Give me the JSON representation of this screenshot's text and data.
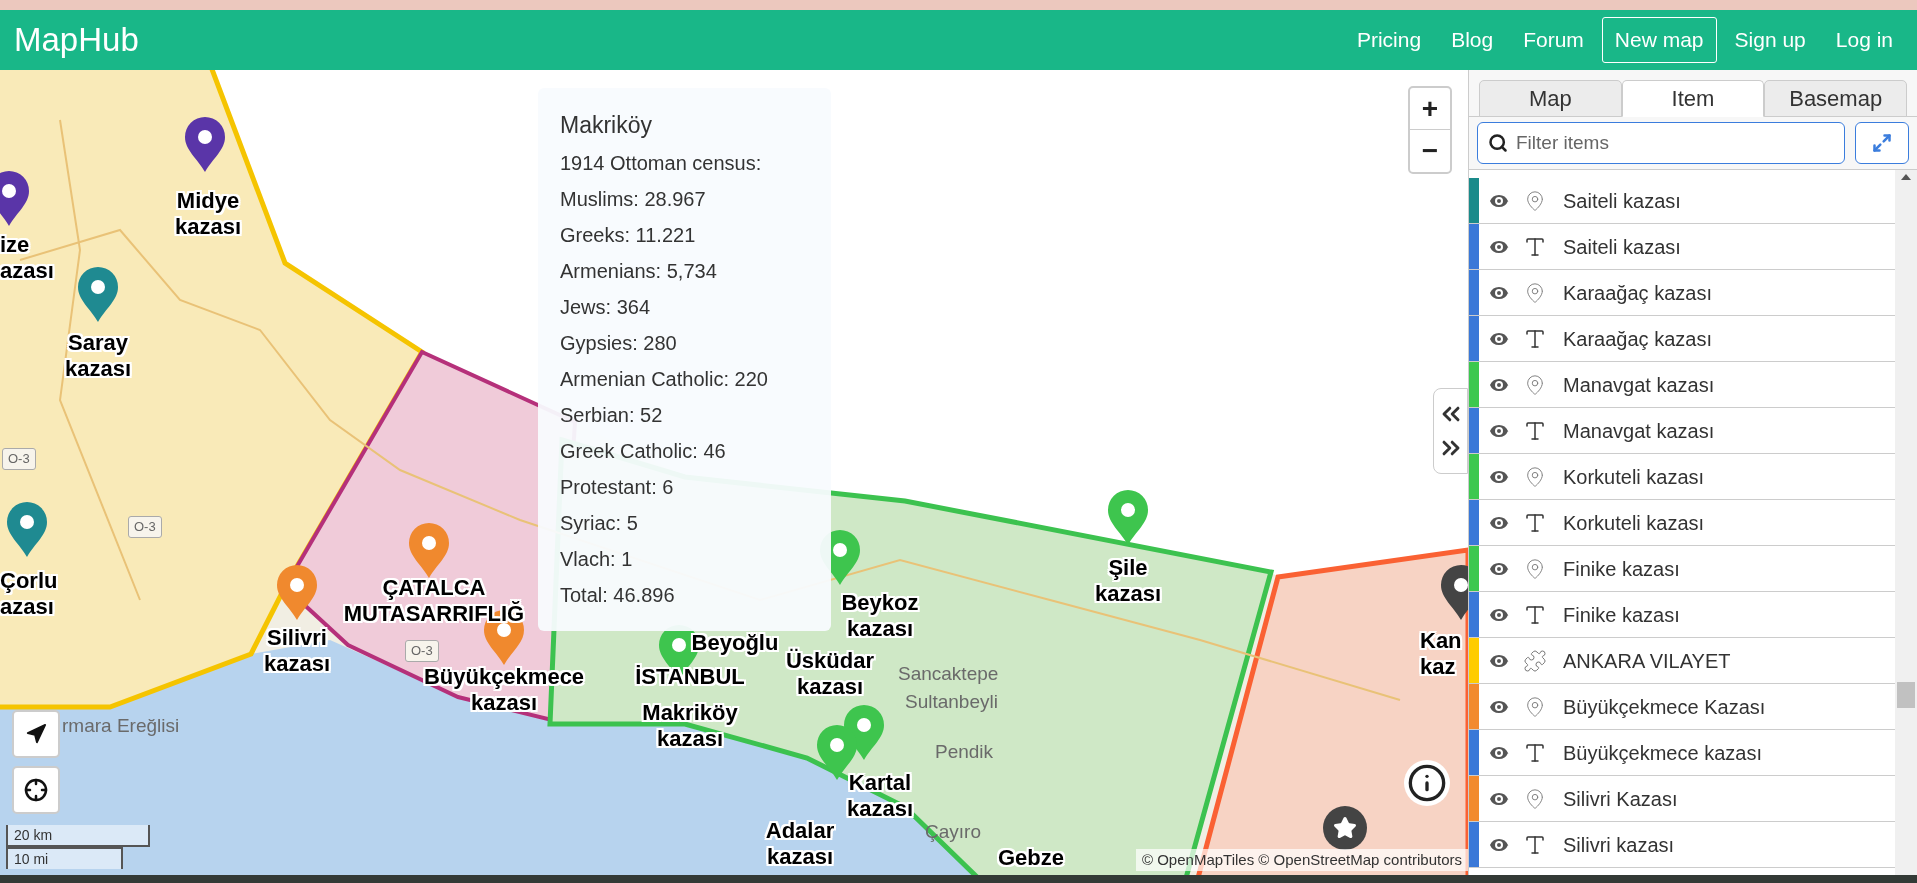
{
  "header": {
    "logo": "MapHub",
    "nav": [
      {
        "label": "Pricing",
        "kind": "link"
      },
      {
        "label": "Blog",
        "kind": "link"
      },
      {
        "label": "Forum",
        "kind": "link"
      },
      {
        "label": "New map",
        "kind": "button"
      },
      {
        "label": "Sign up",
        "kind": "link"
      },
      {
        "label": "Log in",
        "kind": "link"
      }
    ]
  },
  "map": {
    "markers": [
      {
        "kind": "pin",
        "color": "#5a35a8"
      },
      {
        "kind": "pin",
        "color": "#5a35a8"
      },
      {
        "kind": "pin",
        "color": "#1f8a91"
      },
      {
        "kind": "pin",
        "color": "#1f8a91"
      },
      {
        "kind": "pin",
        "color": "#f0892e"
      },
      {
        "kind": "pin",
        "color": "#f0892e"
      },
      {
        "kind": "pin",
        "color": "#f0892e"
      },
      {
        "kind": "pin",
        "color": "#3ec54e"
      },
      {
        "kind": "pin",
        "color": "#3ec54e"
      },
      {
        "kind": "pin",
        "color": "#3ec54e"
      },
      {
        "kind": "pin",
        "color": "#3ec54e"
      },
      {
        "kind": "pin",
        "color": "#3ec54e"
      },
      {
        "kind": "pin",
        "color": "#444444"
      },
      {
        "kind": "star",
        "color": "#444444"
      }
    ],
    "labels": [
      "Midye kazası",
      "ize azası",
      "Saray kazası",
      "Çorlu azası",
      "Silivri kazası",
      "ÇATALCA MUTASARRIFLIĞ",
      "Büyükçekmece kazası",
      "Beykoz kazası",
      "Şile kazası",
      "Beyoğlu",
      "İSTANBUL",
      "Üsküdar kazası",
      "Makriköy kazası",
      "Kartal kazası",
      "Adalar kazası",
      "Gebze",
      "Kan kaz"
    ],
    "place_names": [
      "rmara Ereğlisi",
      "Sancaktepe",
      "Sultanbeyli",
      "Pendik",
      "Çayıro"
    ],
    "road_shields": [
      "O-3",
      "O-3",
      "O-3"
    ],
    "popup": {
      "title": "Makriköy",
      "lines": [
        "1914 Ottoman census:",
        "Muslims: 28.967",
        "Greeks: 11.221",
        "Armenians: 5,734",
        "Jews: 364",
        "Gypsies: 280",
        "Armenian Catholic: 220",
        "Serbian: 52",
        "Greek Catholic: 46",
        "Protestant: 6",
        "Syriac: 5",
        "Vlach: 1",
        "Total: 46.896"
      ]
    },
    "zoom": {
      "in": "+",
      "out": "−"
    },
    "scale": [
      "20 km",
      "10 mi"
    ],
    "attribution": "© OpenMapTiles © OpenStreetMap contributors"
  },
  "sidebar": {
    "tabs": [
      {
        "label": "Map",
        "selected": false
      },
      {
        "label": "Item",
        "selected": true
      },
      {
        "label": "Basemap",
        "selected": false
      }
    ],
    "filter": {
      "placeholder": "Filter items"
    },
    "items": [
      {
        "kind": "marker",
        "color": "#1a8a8a",
        "label": "Saiteli kazası"
      },
      {
        "kind": "text",
        "color": "#3a78d8",
        "label": "Saiteli kazası"
      },
      {
        "kind": "marker",
        "color": "#3a78d8",
        "label": "Karaağaç kazası"
      },
      {
        "kind": "text",
        "color": "#3a78d8",
        "label": "Karaağaç kazası"
      },
      {
        "kind": "marker",
        "color": "#3cc84f",
        "label": "Manavgat kazası"
      },
      {
        "kind": "text",
        "color": "#3a78d8",
        "label": "Manavgat kazası"
      },
      {
        "kind": "marker",
        "color": "#3cc84f",
        "label": "Korkuteli kazası"
      },
      {
        "kind": "text",
        "color": "#3a78d8",
        "label": "Korkuteli kazası"
      },
      {
        "kind": "marker",
        "color": "#3cc84f",
        "label": "Finike kazası"
      },
      {
        "kind": "text",
        "color": "#3a78d8",
        "label": "Finike kazası"
      },
      {
        "kind": "polygon",
        "color": "#ffcc00",
        "label": "ANKARA VILAYET"
      },
      {
        "kind": "marker",
        "color": "#f28a2e",
        "label": "Büyükçekmece Kazası"
      },
      {
        "kind": "text",
        "color": "#3a78d8",
        "label": "Büyükçekmece kazası"
      },
      {
        "kind": "marker",
        "color": "#f28a2e",
        "label": "Silivri Kazası"
      },
      {
        "kind": "text",
        "color": "#3a78d8",
        "label": "Silivri kazası"
      }
    ]
  }
}
